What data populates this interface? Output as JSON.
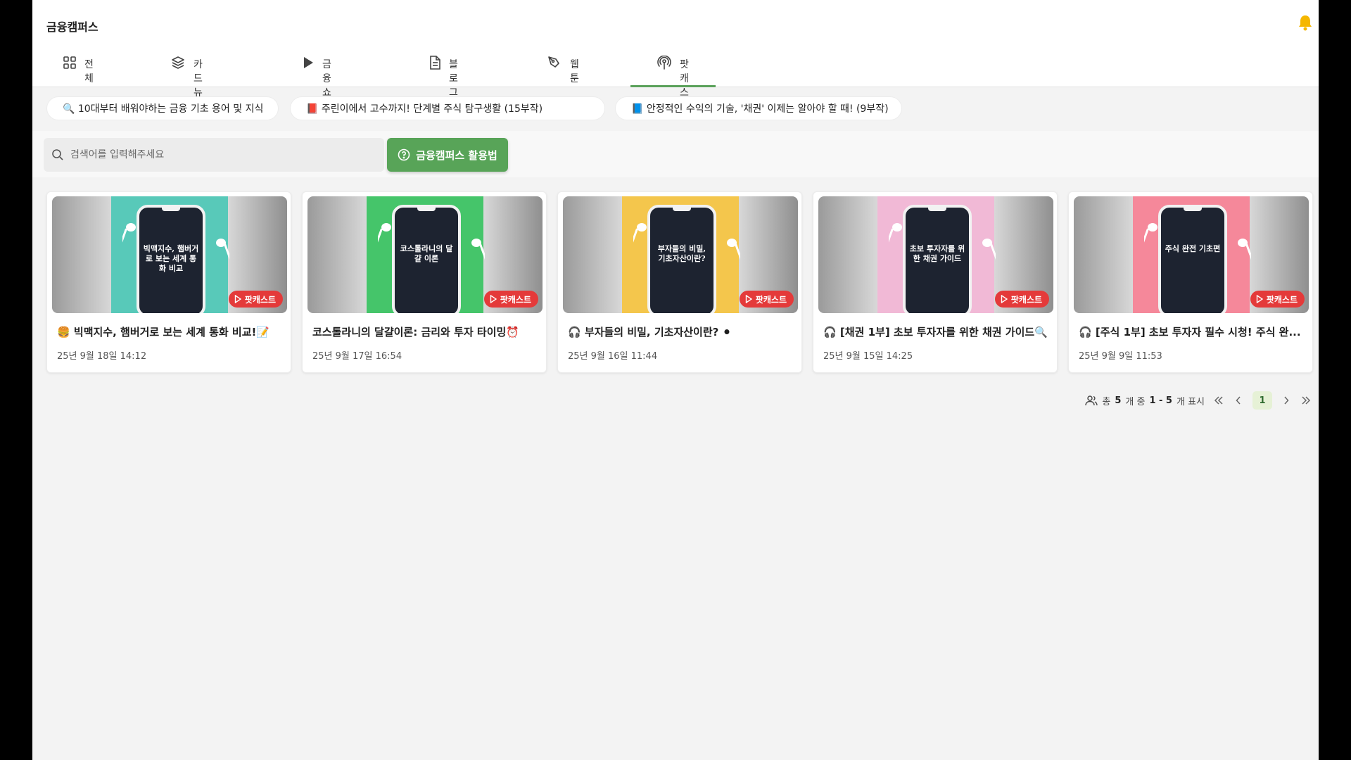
{
  "app": {
    "title": "금융캠퍼스"
  },
  "tabs": [
    {
      "label": "전체",
      "icon": "grid-icon"
    },
    {
      "label": "카드 뉴스",
      "icon": "layers-icon"
    },
    {
      "label": "금융쇼츠",
      "icon": "play-icon"
    },
    {
      "label": "블로그",
      "icon": "document-icon"
    },
    {
      "label": "웹툰",
      "icon": "pen-tool-icon"
    },
    {
      "label": "팟캐스트",
      "icon": "podcast-icon",
      "active": true
    }
  ],
  "chips": [
    "🔍 10대부터 배워야하는 금융 기초 용어 및 지식",
    "📕 주린이에서 고수까지! 단계별 주식 탐구생활 (15부작)",
    "📘 안정적인 수익의 기술, '채권' 이제는 알아야 할 때! (9부작)"
  ],
  "search": {
    "placeholder": "검색어를 입력해주세요",
    "value": ""
  },
  "guide_button": {
    "label": "금융캠퍼스 활용법"
  },
  "cards": [
    {
      "thumb_text": "빅맥지수, 햄버거로 보는 세계 통화 비교",
      "badge": "팟캐스트",
      "title": "🍔 빅맥지수, 햄버거로 보는 세계 통화 비교!📝",
      "date": "25년 9월 18일 14:12",
      "bg": "#58c9b9"
    },
    {
      "thumb_text": "코스톨라니의 달걀 이론",
      "badge": "팟캐스트",
      "title": "코스톨라니의 달걀이론: 금리와 투자 타이밍⏰",
      "date": "25년 9월 17일 16:54",
      "bg": "#45c56a"
    },
    {
      "thumb_text": "부자들의 비밀, 기초자산이란?",
      "badge": "팟캐스트",
      "title": "🎧 부자들의 비밀, 기초자산이란? ⚫",
      "date": "25년 9월 16일 11:44",
      "bg": "#f4c64c"
    },
    {
      "thumb_text": "초보 투자자를 위한 채권 가이드",
      "badge": "팟캐스트",
      "title": "🎧 [채권 1부] 초보 투자자를 위한 채권 가이드🔍",
      "date": "25년 9월 15일 14:25",
      "bg": "#f1b9d6"
    },
    {
      "thumb_text": "주식 완전 기초편",
      "badge": "팟캐스트",
      "title": "🎧 [주식 1부] 초보 투자자 필수 시청! 주식 완...",
      "date": "25년 9월 9일 11:53",
      "bg": "#f5889a"
    }
  ],
  "pagination": {
    "prefix": "총",
    "total": "5",
    "mid": "개 중",
    "range": "1 - 5",
    "suffix": "개 표시",
    "current_page": "1"
  },
  "colors": {
    "accent": "#58a458",
    "badge": "#e43a3a",
    "bell": "#f5b700"
  }
}
